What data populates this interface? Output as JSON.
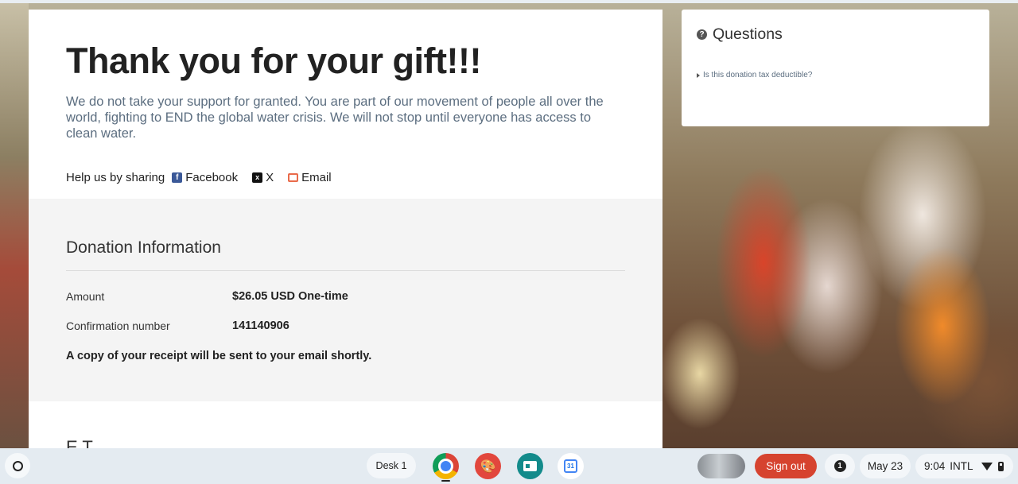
{
  "main": {
    "title": "Thank you for your gift!!!",
    "message": "We do not take your support for granted. You are part of our movement of people all over the world, fighting to END the global water crisis. We will not stop until everyone has access to clean water.",
    "share": {
      "label": "Help us by sharing",
      "facebook": "Facebook",
      "x": "X",
      "email": "Email"
    }
  },
  "donation": {
    "heading": "Donation Information",
    "amount_label": "Amount",
    "amount_value": "$26.05 USD One-time",
    "confirmation_label": "Confirmation number",
    "confirmation_value": "141140906",
    "receipt_note": "A copy of your receipt will be sent to your email shortly.",
    "next_heading_partial": "E      T"
  },
  "questions": {
    "title": "Questions",
    "items": [
      {
        "label": "Is this donation tax deductible?"
      }
    ]
  },
  "shelf": {
    "desk_label": "Desk 1",
    "sign_out": "Sign out",
    "notification_count": "1",
    "date": "May 23",
    "time": "9:04",
    "input_method": "INTL",
    "apps": [
      "chrome",
      "paint",
      "slides",
      "calendar"
    ],
    "calendar_day": "31"
  },
  "colors": {
    "body_text_muted": "#5c6e80",
    "sign_out_bg": "#d6432f",
    "facebook": "#3b5998"
  }
}
